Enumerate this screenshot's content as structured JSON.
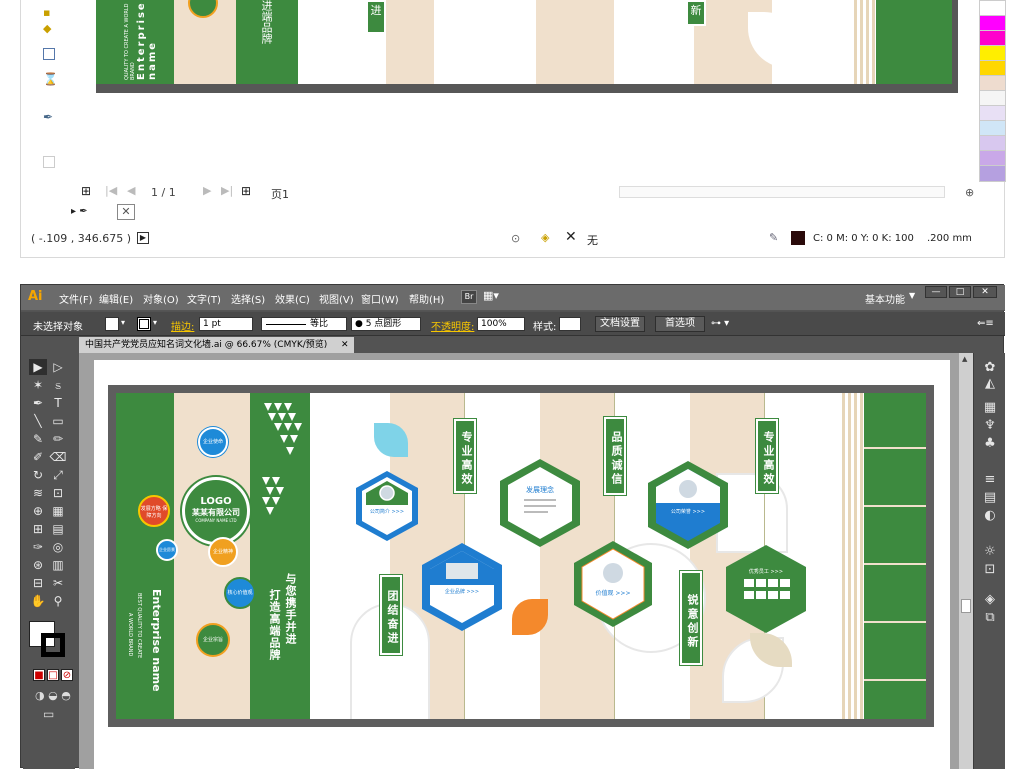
{
  "top_panel": {
    "page_indicator": "1 / 1",
    "page_tab_label": "页1",
    "coords": "( -.109 , 346.675 )",
    "fill_none_label": "无",
    "color_readout": "C: 0 M: 0 Y: 0 K: 100",
    "stroke_readout": ".200 mm",
    "art_text": {
      "enterprise": "Enterprise name",
      "slogan": "QUALITY TO CREATE A WORLD BRAND",
      "brand_top": "进端品牌",
      "ban1": "进",
      "ban2": "新"
    }
  },
  "swatch_colors": [
    "#ffffff",
    "#ff00ff",
    "#ff00cc",
    "#ffee00",
    "#ffd700",
    "#eedccf",
    "#f5f5f5",
    "#e8e0f5",
    "#d0e6f7",
    "#d8c8ef",
    "#c9a8e8",
    "#b5a0e0"
  ],
  "app": {
    "logo": "Ai",
    "menus": [
      "文件(F)",
      "编辑(E)",
      "对象(O)",
      "文字(T)",
      "选择(S)",
      "效果(C)",
      "视图(V)",
      "窗口(W)",
      "帮助(H)"
    ],
    "bridge_label": "Br",
    "workspace": "基本功能",
    "window_controls": [
      "—",
      "□",
      "✕"
    ]
  },
  "control_bar": {
    "selection_label": "未选择对象",
    "stroke_label": "描边:",
    "stroke_value": "1 pt",
    "stroke_style": "等比",
    "brush_label": "5 点圆形",
    "opacity_label": "不透明度:",
    "opacity_value": "100%",
    "style_label": "样式:",
    "doc_setup": "文档设置",
    "preferences": "首选项"
  },
  "document": {
    "tab_title": "中国共产党党员应知名词文化墙.ai @ 66.67% (CMYK/预览)",
    "tab_close": "✕"
  },
  "artwork": {
    "logo_text": "LOGO",
    "company_name": "某某有限公司",
    "company_en": "COMPANY NAME LTD",
    "enterprise_name": "Enterprise name",
    "slogan_1": "BEST QUALITY TO CREATE",
    "slogan_2": "A WORLD BRAND",
    "brand_line_1": "与您携手并进",
    "brand_line_2": "打造高端品牌",
    "circles": {
      "c1": "企业使命",
      "c2": "发展方略 保障方向",
      "c3": "企业愿景",
      "c4": "企业精神",
      "c5": "核心价值观",
      "c6": "企业宗旨"
    },
    "banners": [
      "专业高效",
      "品质诚信",
      "专业高效",
      "团结奋进",
      "锐意创新"
    ],
    "hex_labels": {
      "company_profile": "公司简介 >>>",
      "development": "发展理念",
      "honor": "公司荣誉 >>>",
      "brand": "企业品牌 >>>",
      "values": "价值观 >>>",
      "staff": "优秀员工 >>>"
    }
  }
}
